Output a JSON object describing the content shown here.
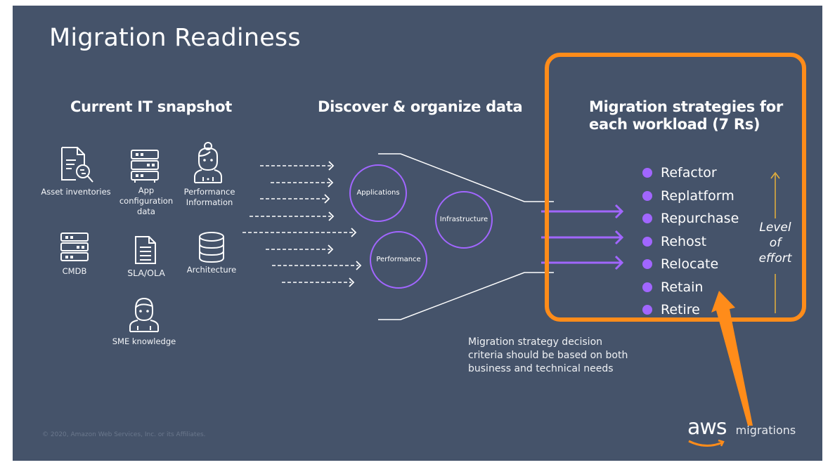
{
  "slide": {
    "title": "Migration Readiness",
    "colors": {
      "background": "#45536a",
      "accent_purple": "#a166ff",
      "highlight_orange": "#ff8c1a",
      "effort_arrow": "#e8b23a",
      "text": "#ffffff"
    }
  },
  "current_it": {
    "heading": "Current IT snapshot",
    "items": [
      {
        "label": "Asset inventories",
        "icon": "document-search-icon"
      },
      {
        "label": "App configuration data",
        "label_lines": [
          "App",
          "configuration",
          "data"
        ],
        "icon": "server-rack-icon"
      },
      {
        "label": "Performance Information",
        "label_lines": [
          "Performance",
          "Information"
        ],
        "icon": "female-person-icon"
      },
      {
        "label": "CMDB",
        "icon": "server-rack-icon"
      },
      {
        "label": "SLA/OLA",
        "icon": "document-icon"
      },
      {
        "label": "Architecture",
        "icon": "database-icon"
      },
      {
        "label": "SME knowledge",
        "icon": "male-person-icon"
      }
    ]
  },
  "discover": {
    "heading": "Discover & organize data",
    "circles": [
      {
        "label": "Applications"
      },
      {
        "label": "Infrastructure"
      },
      {
        "label": "Performance"
      }
    ]
  },
  "strategies": {
    "heading_lines": [
      "Migration strategies for",
      "each workload (7 Rs)"
    ],
    "items": [
      "Refactor",
      "Replatform",
      "Repurchase",
      "Rehost",
      "Relocate",
      "Retain",
      "Retire"
    ],
    "effort_label_lines": [
      "Level",
      "of",
      "effort"
    ]
  },
  "note_lines": [
    "Migration strategy decision",
    "criteria should be based on both",
    "business and technical needs"
  ],
  "footer": {
    "copyright": "© 2020, Amazon Web Services, Inc. or its Affiliates.",
    "logo_word": "aws",
    "logo_sub": "migrations"
  }
}
